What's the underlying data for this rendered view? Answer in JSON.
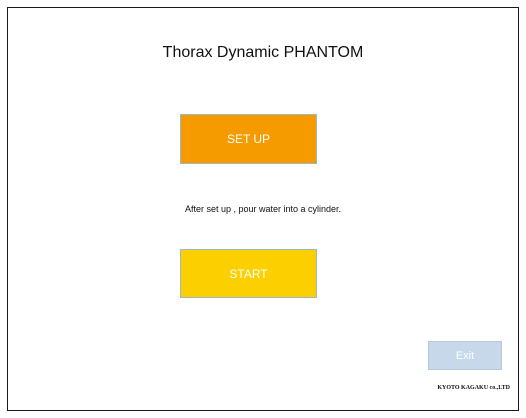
{
  "app": {
    "title": "Thorax Dynamic PHANTOM"
  },
  "buttons": {
    "setup_label": "SET UP",
    "start_label": "START",
    "exit_label": "Exit"
  },
  "instruction": "After set up , pour water into a cylinder.",
  "footer": {
    "company": "KYOTO KAGAKU co.,LTD"
  },
  "colors": {
    "setup_button": "#f59b00",
    "start_button": "#fccf00",
    "exit_button": "#c7d8ea"
  }
}
